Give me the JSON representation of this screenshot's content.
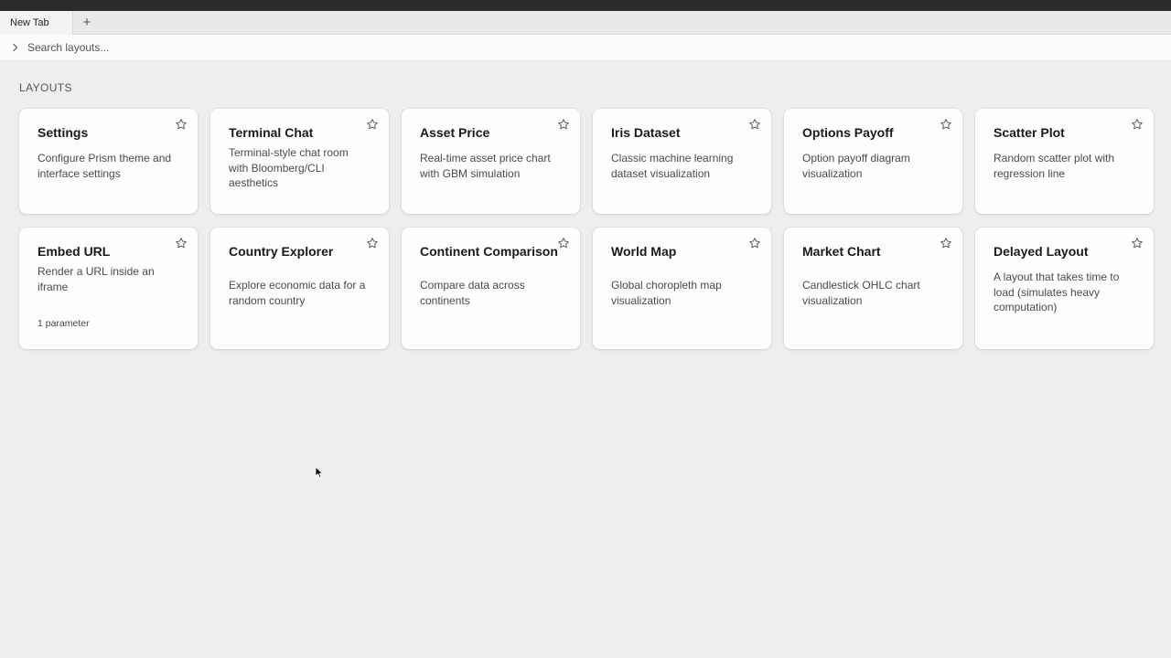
{
  "tabs": [
    {
      "label": "New Tab"
    }
  ],
  "new_tab_label": "+",
  "search": {
    "placeholder": "Search layouts...",
    "value": ""
  },
  "section_heading": "LAYOUTS",
  "layouts": [
    {
      "title": "Settings",
      "description": "Configure Prism theme and interface settings",
      "icon": "star-icon"
    },
    {
      "title": "Terminal Chat",
      "description": "Terminal-style chat room with Bloomberg/CLI aesthetics",
      "icon": "star-icon"
    },
    {
      "title": "Asset Price",
      "description": "Real-time asset price chart with GBM simulation",
      "icon": "star-icon"
    },
    {
      "title": "Iris Dataset",
      "description": "Classic machine learning dataset visualization",
      "icon": "star-icon"
    },
    {
      "title": "Options Payoff",
      "description": "Option payoff diagram visualization",
      "icon": "star-icon"
    },
    {
      "title": "Scatter Plot",
      "description": "Random scatter plot with regression line",
      "icon": "star-icon"
    },
    {
      "title": "Embed URL",
      "description": "Render a URL inside an iframe",
      "param": "1 parameter",
      "icon": "star-icon"
    },
    {
      "title": "Country Explorer",
      "description": "Explore economic data for a random country",
      "icon": "star-icon"
    },
    {
      "title": "Continent Comparison",
      "description": "Compare data across continents",
      "icon": "star-icon"
    },
    {
      "title": "World Map",
      "description": "Global choropleth map visualization",
      "icon": "star-icon"
    },
    {
      "title": "Market Chart",
      "description": "Candlestick OHLC chart visualization",
      "icon": "star-icon"
    },
    {
      "title": "Delayed Layout",
      "description": "A layout that takes time to load (simulates heavy computation)",
      "icon": "star-icon"
    }
  ],
  "colors": {
    "background": "#eeedef",
    "card": "#fdfdfe",
    "topbar": "#2b2b2d"
  }
}
